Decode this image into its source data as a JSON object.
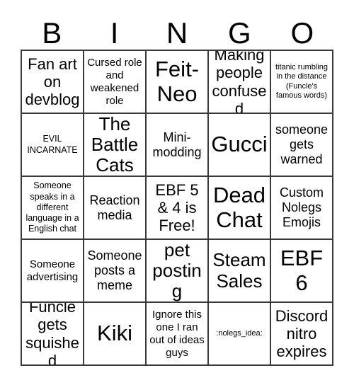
{
  "card": {
    "title": "BINGO",
    "header_letters": [
      "B",
      "I",
      "N",
      "G",
      "O"
    ],
    "columns": 5,
    "rows": 5,
    "border_color": "#3a3a3a",
    "background_color": "#ffffff",
    "text_color": "#000000",
    "cells": [
      [
        {
          "text": "Fan art on devblog",
          "size": "l"
        },
        {
          "text": "Cursed role and weakened role",
          "size": "s"
        },
        {
          "text": "Feit-Neo",
          "size": "xxl"
        },
        {
          "text": "Making people confused",
          "size": "l"
        },
        {
          "text": "titanic rumbling in the distance (Funcle's famous words)",
          "size": "xxs"
        }
      ],
      [
        {
          "text": "EVIL INCARNATE",
          "size": "xs"
        },
        {
          "text": "The Battle Cats",
          "size": "xl"
        },
        {
          "text": "Mini-modding",
          "size": "m"
        },
        {
          "text": "Gucci",
          "size": "xxl"
        },
        {
          "text": "someone gets warned",
          "size": "m"
        }
      ],
      [
        {
          "text": "Someone speaks in a different language in a English chat",
          "size": "xs"
        },
        {
          "text": "Reaction media",
          "size": "m"
        },
        {
          "text": "EBF 5 & 4 is Free!",
          "size": "l"
        },
        {
          "text": "Dead Chat",
          "size": "xxl"
        },
        {
          "text": "Custom Nolegs Emojis",
          "size": "m"
        }
      ],
      [
        {
          "text": "Someone advertising",
          "size": "s"
        },
        {
          "text": "Someone posts a meme",
          "size": "m"
        },
        {
          "text": "pet posting",
          "size": "xl"
        },
        {
          "text": "Steam Sales",
          "size": "xl"
        },
        {
          "text": "EBF 6",
          "size": "xxl"
        }
      ],
      [
        {
          "text": "Funcle gets squished",
          "size": "l"
        },
        {
          "text": "Kiki",
          "size": "xxl"
        },
        {
          "text": "Ignore this one I ran out of ideas guys",
          "size": "s"
        },
        {
          "text": ":nolegs_idea:",
          "size": "xxs"
        },
        {
          "text": "Discord nitro expires",
          "size": "l"
        }
      ]
    ]
  }
}
